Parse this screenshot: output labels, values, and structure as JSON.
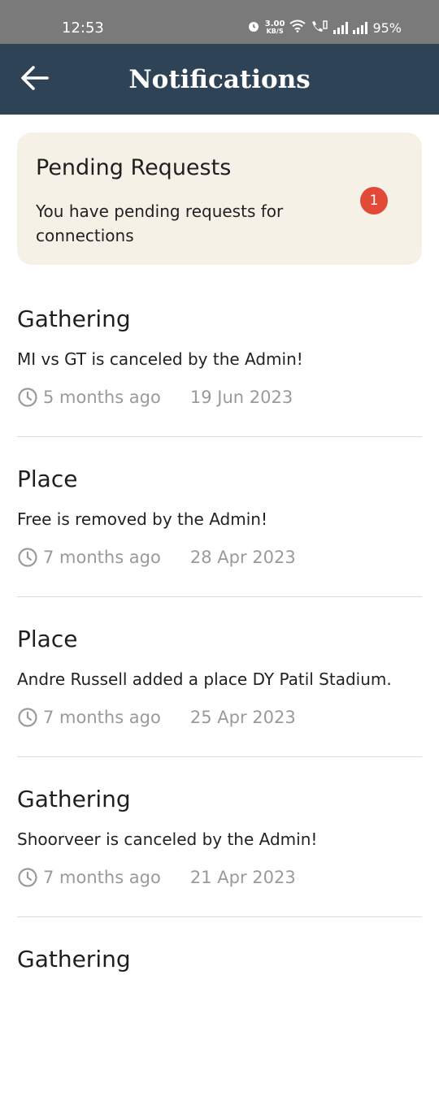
{
  "status_bar": {
    "time": "12:53",
    "net_speed_value": "3.00",
    "net_speed_unit": "KB/S",
    "battery": "95%"
  },
  "header": {
    "back_icon": "arrow-left-icon",
    "title": "Notifications"
  },
  "pending": {
    "title": "Pending Requests",
    "description": "You have pending requests for connections",
    "badge_count": "1",
    "badge_color": "#e04a36",
    "card_color": "#f6f1e7"
  },
  "notifications": [
    {
      "type": "Gathering",
      "message": "MI vs GT is canceled by the Admin!",
      "relative_time": "5 months ago",
      "date": "19 Jun 2023"
    },
    {
      "type": "Place",
      "message": "Free is removed by the Admin!",
      "relative_time": "7 months ago",
      "date": "28 Apr 2023"
    },
    {
      "type": "Place",
      "message": "Andre Russell added a place DY Patil Stadium.",
      "relative_time": "7 months ago",
      "date": "25 Apr 2023"
    },
    {
      "type": "Gathering",
      "message": "Shoorveer is canceled by the Admin!",
      "relative_time": "7 months ago",
      "date": "21 Apr 2023"
    },
    {
      "type": "Gathering",
      "message": "",
      "relative_time": "",
      "date": ""
    }
  ],
  "colors": {
    "status_bar": "#7a7a7a",
    "app_bar": "#2f4356",
    "meta_text": "#9a9a9a"
  }
}
